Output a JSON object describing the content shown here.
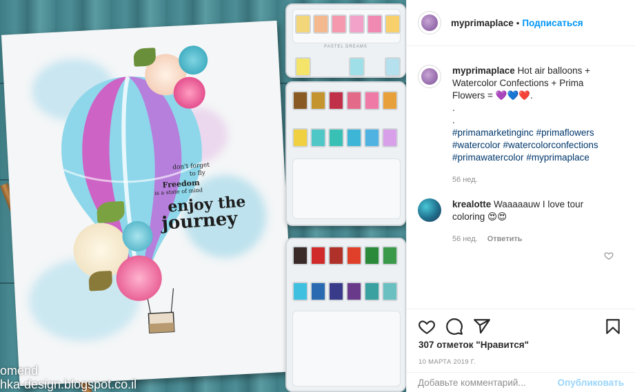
{
  "post": {
    "author": "myprimaplace",
    "follow_label": "Подписаться",
    "separator": "•"
  },
  "caption": {
    "username": "myprimaplace",
    "text": "Hot air balloons + Watercolor Confections + Prima Flowers = 💜💙❤️.",
    "dot1": ".",
    "dot2": ".",
    "hashtags": [
      "#primamarketinginc",
      "#primaflowers",
      "#watercolor",
      "#watercolorconfections",
      "#primawatercolor",
      "#myprimaplace"
    ],
    "age": "56 нед."
  },
  "comment": {
    "username": "krealotte",
    "text": "Waaaaauw I love tour coloring 😍😍",
    "age": "56 нед.",
    "reply_label": "Ответить"
  },
  "actions": {
    "like_icon": "heart-icon",
    "comment_icon": "comment-icon",
    "share_icon": "paper-plane-icon",
    "save_icon": "bookmark-icon"
  },
  "likes": "307 отметок \"Нравится\"",
  "date": "10 МАРТА 2019 Г.",
  "add_comment": {
    "placeholder": "Добавьте комментарий...",
    "post_label": "Опубликовать"
  },
  "image": {
    "stamp_line1": "don't forget",
    "stamp_line2": "to fly",
    "stamp_freedom": "Freedom",
    "stamp_state": "is a state of mind",
    "stamp_enjoy": "enjoy the",
    "stamp_journey": "journey",
    "watermark1": "omend",
    "watermark2": "hka-design.blogspot.co.il",
    "palette_label": "PASTEL DREAMS"
  },
  "colors": {
    "link": "#0095f6",
    "hashtag": "#00376b",
    "muted": "#8e8e8e"
  }
}
